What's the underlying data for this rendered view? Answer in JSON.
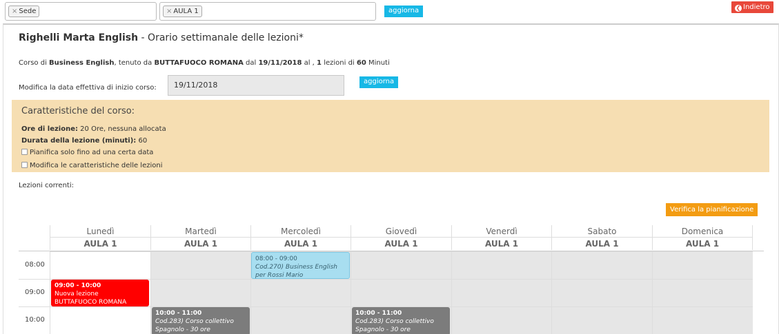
{
  "filters": {
    "sede_chip": "Sede",
    "aula_chip": "AULA 1",
    "remove_glyph": "×",
    "update_label": "aggiorna"
  },
  "back_button": {
    "label": "Indietro",
    "icon": "arrow-left-circle-icon"
  },
  "header": {
    "name": "Righelli Marta English",
    "subtitle": " - Orario settimanale delle lezioni*"
  },
  "course": {
    "p1": "Corso di ",
    "name": "Business English",
    "p2": ", tenuto da ",
    "teacher": "BUTTAFUOCO ROMANA",
    "p3": " dal ",
    "start_date": "19/11/2018",
    "p4": " al , ",
    "lessons": "1",
    "p5": " lezioni di ",
    "minutes": "60",
    "p6": " Minuti"
  },
  "start_date_field": {
    "label": "Modifica la data effettiva di inizio corso:",
    "value": "19/11/2018",
    "update_label": "aggiorna"
  },
  "features": {
    "title": "Caratteristiche del corso:",
    "hours_label": "Ore di lezione:",
    "hours_value": " 20 Ore, nessuna allocata",
    "duration_label": "Durata della lezione (minuti):",
    "duration_value": " 60",
    "opt1": "Pianifica solo fino ad una certa data",
    "opt2": "Modifica le caratteristiche delle lezioni"
  },
  "current_lessons_label": "Lezioni correnti:",
  "verify_button": "Verifica la pianificazione",
  "calendar": {
    "days": [
      {
        "name": "Lunedì",
        "room": "AULA 1"
      },
      {
        "name": "Martedì",
        "room": "AULA 1"
      },
      {
        "name": "Mercoledì",
        "room": "AULA 1"
      },
      {
        "name": "Giovedì",
        "room": "AULA 1"
      },
      {
        "name": "Venerdì",
        "room": "AULA 1"
      },
      {
        "name": "Sabato",
        "room": "AULA 1"
      },
      {
        "name": "Domenica",
        "room": "AULA 1"
      }
    ],
    "times": [
      "08:00",
      "09:00",
      "10:00"
    ],
    "events": [
      {
        "time": "08:00 - 09:00",
        "desc": "Cod.270) Business English per Rossi Mario"
      },
      {
        "time": "09:00 - 10:00",
        "desc": "Nuova lezione",
        "teacher": "BUTTAFUOCO ROMANA"
      },
      {
        "time": "10:00 - 11:00",
        "desc": "Cod.283) Corso collettivo Spagnolo - 30 ore"
      },
      {
        "time": "10:00 - 11:00",
        "desc": "Cod.283) Corso collettivo Spagnolo - 30 ore"
      }
    ]
  },
  "colors": {
    "accent_cyan": "#17b8e6",
    "back_red": "#e8483a",
    "verify_orange": "#f39c12",
    "features_bg": "#f6deb2",
    "new_lesson_red": "#ff0000",
    "existing_lesson_blue": "#a8def0",
    "other_lesson_gray": "#7c7c7c"
  }
}
